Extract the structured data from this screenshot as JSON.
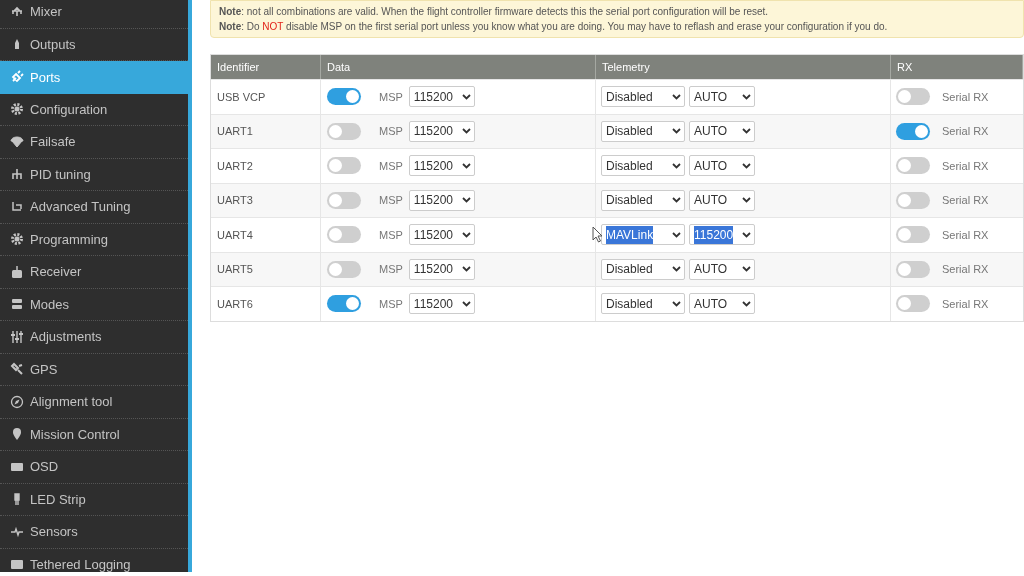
{
  "sidebar": {
    "items": [
      {
        "label": "Mixer",
        "selected": false
      },
      {
        "label": "Outputs",
        "selected": false
      },
      {
        "label": "Ports",
        "selected": true
      },
      {
        "label": "Configuration",
        "selected": false
      },
      {
        "label": "Failsafe",
        "selected": false
      },
      {
        "label": "PID tuning",
        "selected": false
      },
      {
        "label": "Advanced Tuning",
        "selected": false
      },
      {
        "label": "Programming",
        "selected": false
      },
      {
        "label": "Receiver",
        "selected": false
      },
      {
        "label": "Modes",
        "selected": false
      },
      {
        "label": "Adjustments",
        "selected": false
      },
      {
        "label": "GPS",
        "selected": false
      },
      {
        "label": "Alignment tool",
        "selected": false
      },
      {
        "label": "Mission Control",
        "selected": false
      },
      {
        "label": "OSD",
        "selected": false
      },
      {
        "label": "LED Strip",
        "selected": false
      },
      {
        "label": "Sensors",
        "selected": false
      },
      {
        "label": "Tethered Logging",
        "selected": false
      }
    ]
  },
  "notes": [
    {
      "text": "**Note**: not all combinations are valid. When the flight controller firmware detects this the serial port configuration will be reset."
    },
    {
      "text": "**Note**: Do ",
      "warning": "NOT",
      "rest": " disable MSP on the first serial port unless you know what you are doing. You may have to reflash and erase your configuration if you do."
    }
  ],
  "table": {
    "columns": [
      "Identifier",
      "Data",
      "Telemetry",
      "RX"
    ],
    "rows": [
      {
        "identifier": "USB VCP",
        "data": {
          "on": true,
          "protocol": "MSP",
          "baud": "115200"
        },
        "telemetry": {
          "protocol": "Disabled",
          "baud": "AUTO",
          "highlighted": false
        },
        "rx": {
          "on": false,
          "label": "Serial RX"
        }
      },
      {
        "identifier": "UART1",
        "data": {
          "on": false,
          "protocol": "MSP",
          "baud": "115200"
        },
        "telemetry": {
          "protocol": "Disabled",
          "baud": "AUTO",
          "highlighted": false
        },
        "rx": {
          "on": true,
          "label": "Serial RX"
        }
      },
      {
        "identifier": "UART2",
        "data": {
          "on": false,
          "protocol": "MSP",
          "baud": "115200"
        },
        "telemetry": {
          "protocol": "Disabled",
          "baud": "AUTO",
          "highlighted": false
        },
        "rx": {
          "on": false,
          "label": "Serial RX"
        }
      },
      {
        "identifier": "UART3",
        "data": {
          "on": false,
          "protocol": "MSP",
          "baud": "115200"
        },
        "telemetry": {
          "protocol": "Disabled",
          "baud": "AUTO",
          "highlighted": false
        },
        "rx": {
          "on": false,
          "label": "Serial RX"
        }
      },
      {
        "identifier": "UART4",
        "data": {
          "on": false,
          "protocol": "MSP",
          "baud": "115200"
        },
        "telemetry": {
          "protocol": "MAVLink",
          "baud": "115200",
          "highlighted": true
        },
        "rx": {
          "on": false,
          "label": "Serial RX"
        }
      },
      {
        "identifier": "UART5",
        "data": {
          "on": false,
          "protocol": "MSP",
          "baud": "115200"
        },
        "telemetry": {
          "protocol": "Disabled",
          "baud": "AUTO",
          "highlighted": false
        },
        "rx": {
          "on": false,
          "label": "Serial RX"
        }
      },
      {
        "identifier": "UART6",
        "data": {
          "on": true,
          "protocol": "MSP",
          "baud": "115200"
        },
        "telemetry": {
          "protocol": "Disabled",
          "baud": "AUTO",
          "highlighted": false
        },
        "rx": {
          "on": false,
          "label": "Serial RX"
        }
      }
    ]
  }
}
